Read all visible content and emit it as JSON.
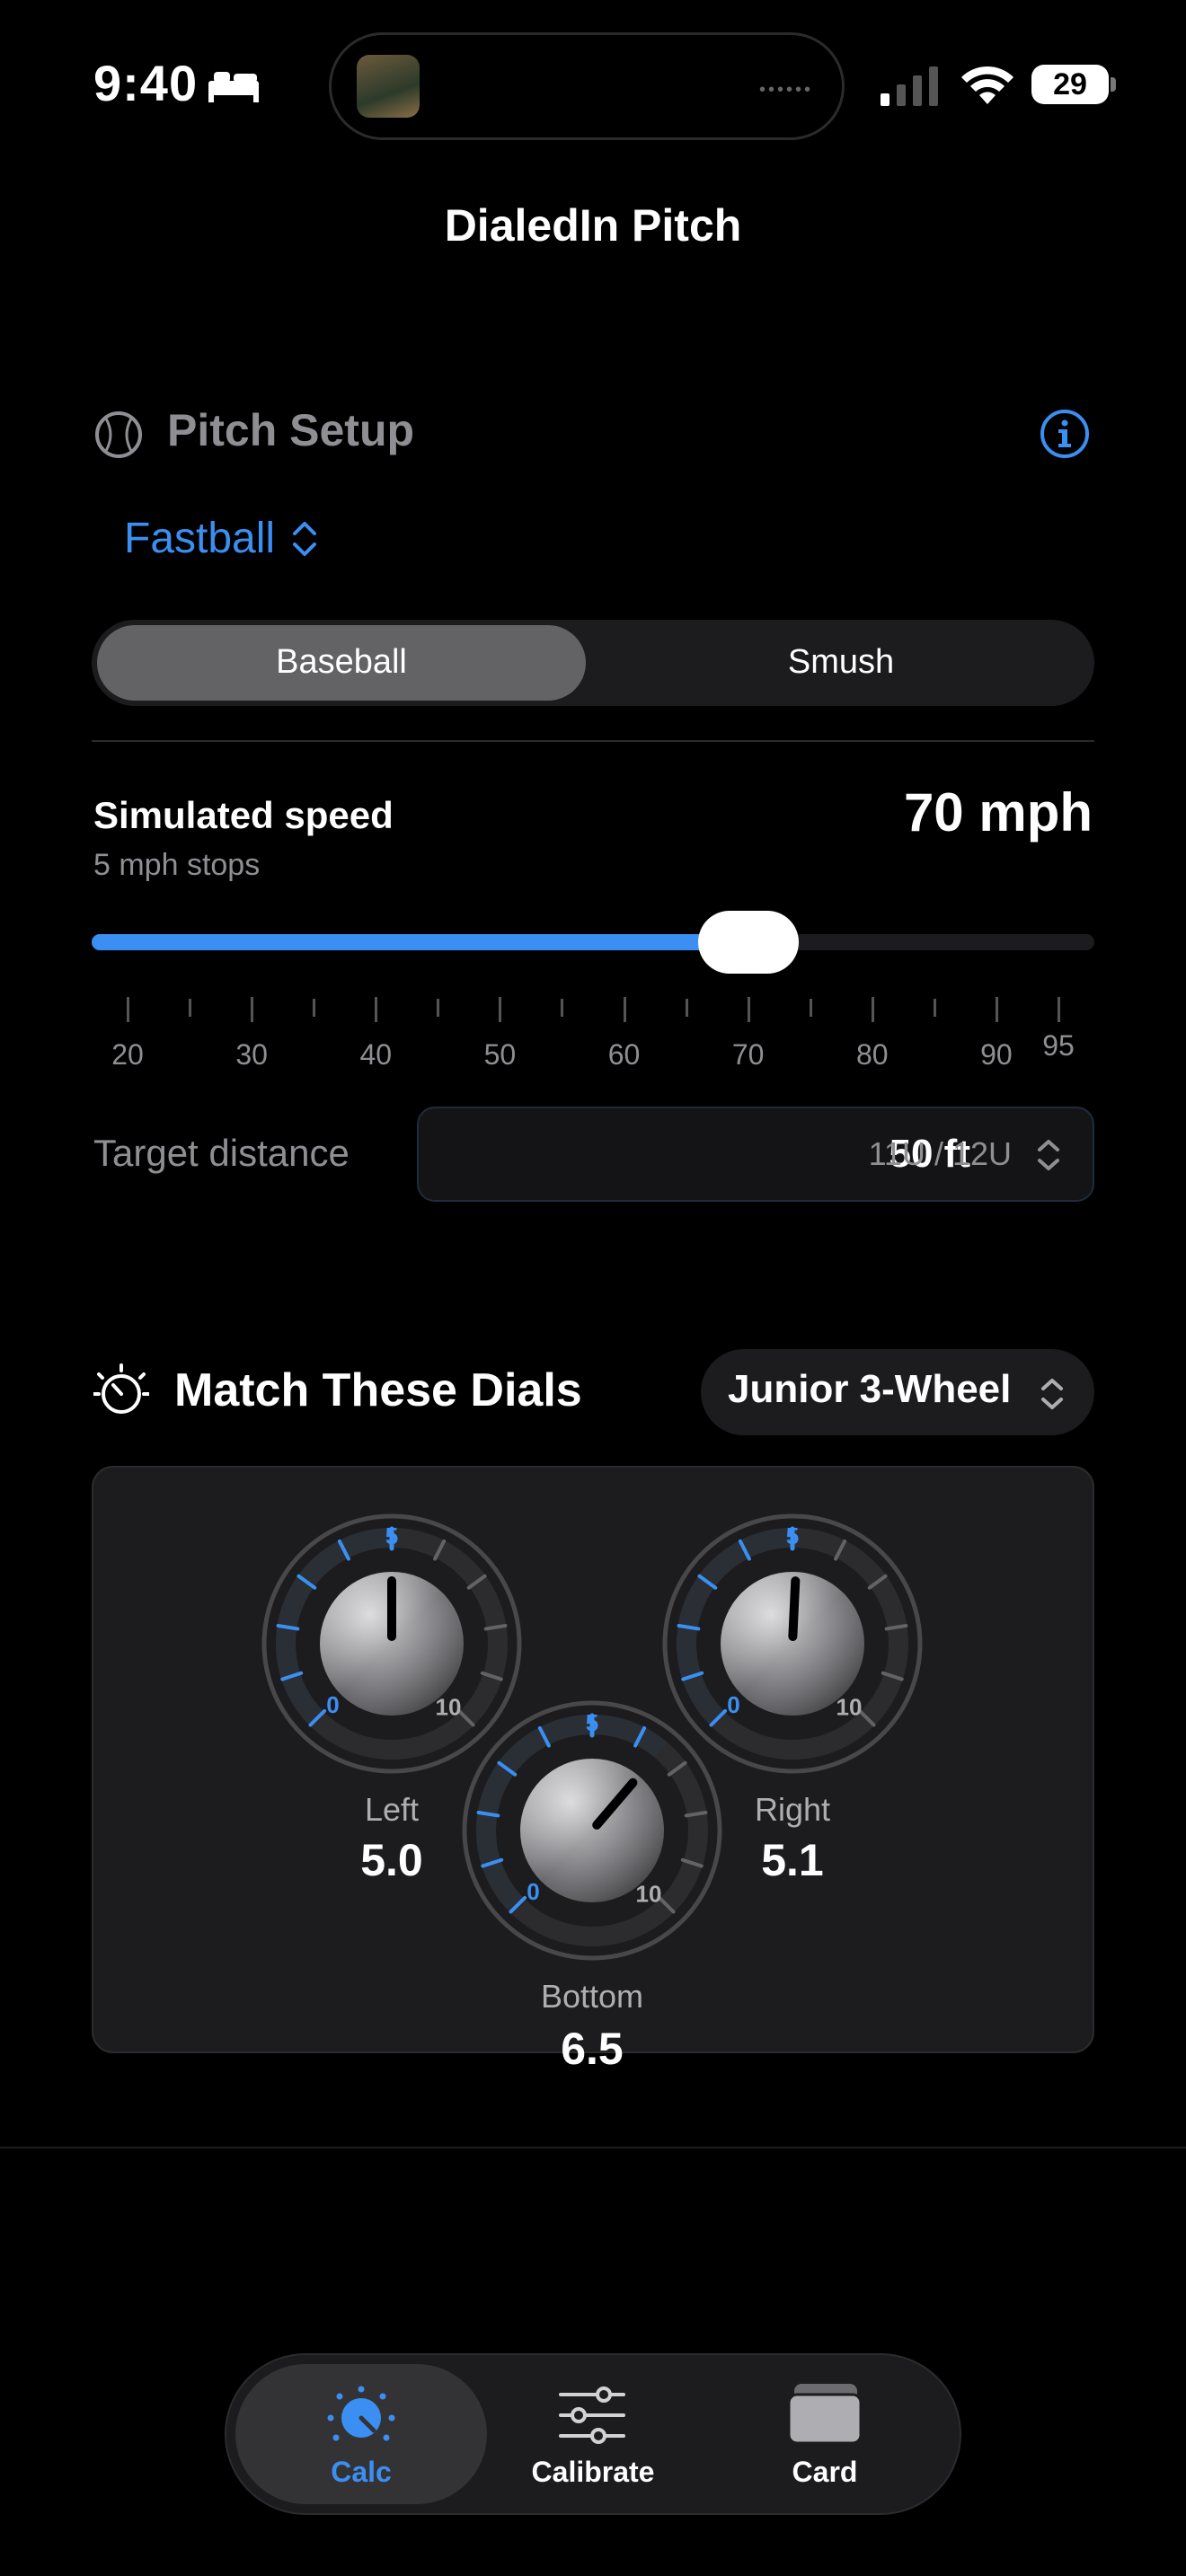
{
  "status_bar": {
    "time": "9:40",
    "battery": "29",
    "sleep_icon": "bed-icon"
  },
  "app": {
    "title": "DialedIn Pitch"
  },
  "pitch_setup": {
    "title": "Pitch Setup",
    "pitch_type": "Fastball",
    "ball_options": [
      "Baseball",
      "Smush"
    ],
    "selected_ball": "Baseball"
  },
  "speed": {
    "label": "Simulated speed",
    "sublabel": "5 mph stops",
    "value_text": "70 mph",
    "value": 70,
    "min": 20,
    "max": 95,
    "tick_labels": [
      "20",
      "30",
      "40",
      "50",
      "60",
      "70",
      "80",
      "90",
      "95"
    ]
  },
  "distance": {
    "label": "Target distance",
    "value": "50 ft",
    "group": "11U / 12U"
  },
  "dials_section": {
    "title": "Match These Dials",
    "machine": "Junior 3-Wheel",
    "dials": [
      {
        "name": "Left",
        "value_text": "5.0",
        "value": 5.0,
        "min_label": "0",
        "mid_label": "5",
        "max_label": "10"
      },
      {
        "name": "Right",
        "value_text": "5.1",
        "value": 5.1,
        "min_label": "0",
        "mid_label": "5",
        "max_label": "10"
      },
      {
        "name": "Bottom",
        "value_text": "6.5",
        "value": 6.5,
        "min_label": "0",
        "mid_label": "5",
        "max_label": "10"
      }
    ]
  },
  "tabs": [
    {
      "label": "Calc",
      "icon": "dial-icon",
      "active": true
    },
    {
      "label": "Calibrate",
      "icon": "sliders-icon",
      "active": false
    },
    {
      "label": "Card",
      "icon": "cards-icon",
      "active": false
    }
  ],
  "colors": {
    "accent": "#3b8ff2",
    "background": "#000000",
    "card": "#1c1c1e"
  }
}
